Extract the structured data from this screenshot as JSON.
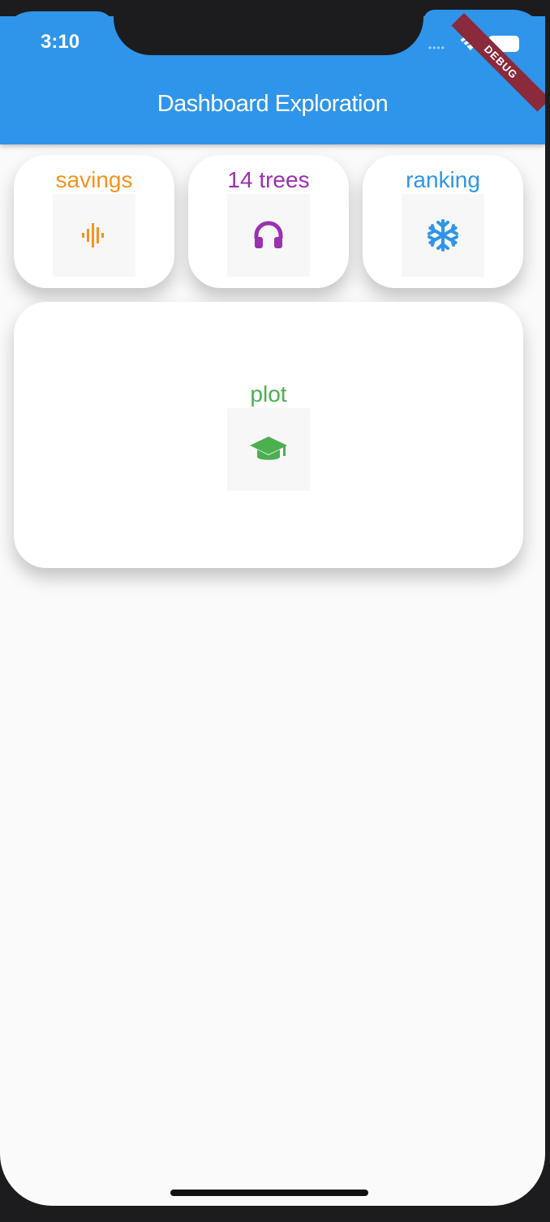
{
  "status_bar": {
    "time": "3:10",
    "debug_label": "DEBUG"
  },
  "app_bar": {
    "title": "Dashboard Exploration",
    "color": "#2f95ea"
  },
  "cards": [
    {
      "label": "savings",
      "icon": "graphic-eq-icon",
      "color": "#f5931e"
    },
    {
      "label": "14 trees",
      "icon": "headphones-icon",
      "color": "#9b30b0"
    },
    {
      "label": "ranking",
      "icon": "snowflake-icon",
      "color": "#2f95ea"
    }
  ],
  "main_card": {
    "label": "plot",
    "icon": "graduation-cap-icon",
    "color": "#4caf50"
  }
}
